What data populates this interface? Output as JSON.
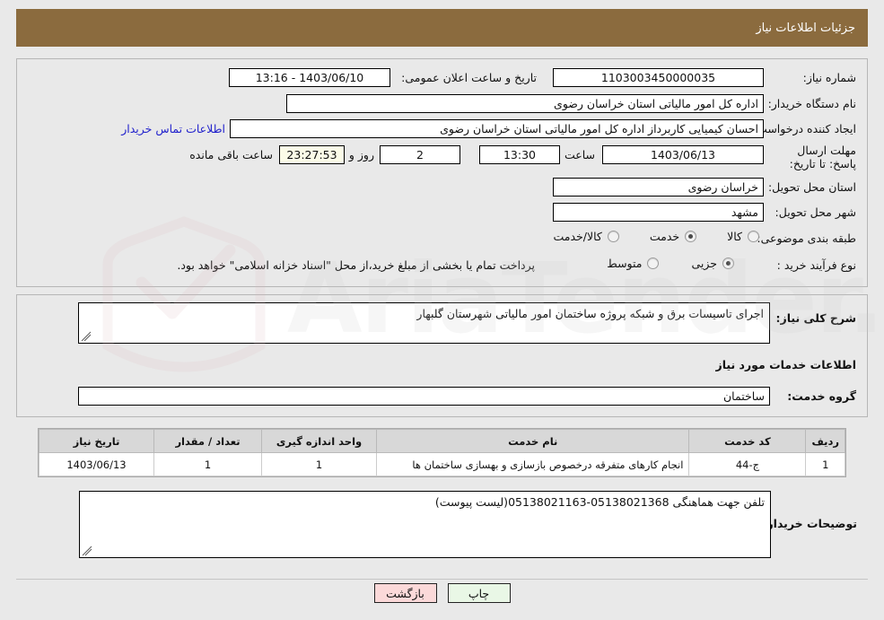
{
  "header": {
    "title": "جزئیات اطلاعات نیاز"
  },
  "fields": {
    "need_number_label": "شماره نیاز:",
    "need_number_value": "1103003450000035",
    "announce_label": "تاریخ و ساعت اعلان عمومی:",
    "announce_value": "1403/06/10 - 13:16",
    "buyer_org_label": "نام دستگاه خریدار:",
    "buyer_org_value": "اداره کل امور مالیاتی استان خراسان رضوی",
    "creator_label": "ایجاد کننده درخواست:",
    "creator_value": "احسان کیمیایی کاربرداز اداره کل امور مالیاتی استان خراسان رضوی",
    "contact_link": "اطلاعات تماس خریدار",
    "deadline_label": "مهلت ارسال پاسخ: تا تاریخ:",
    "deadline_date": "1403/06/13",
    "hour_label": "ساعت",
    "hour_value": "13:30",
    "days_value": "2",
    "days_label": "روز و",
    "timer_value": "23:27:53",
    "timer_label": "ساعت باقی مانده",
    "province_label": "استان محل تحویل:",
    "province_value": "خراسان رضوی",
    "city_label": "شهر محل تحویل:",
    "city_value": "مشهد",
    "category_label": "طبقه بندی موضوعی:",
    "process_label": "نوع فرآیند خرید :",
    "payment_note": "پرداخت تمام یا بخشی از مبلغ خرید،از محل \"اسناد خزانه اسلامی\" خواهد بود."
  },
  "category_options": [
    {
      "label": "کالا",
      "selected": false
    },
    {
      "label": "خدمت",
      "selected": true
    },
    {
      "label": "کالا/خدمت",
      "selected": false
    }
  ],
  "process_options": [
    {
      "label": "جزیی",
      "selected": true
    },
    {
      "label": "متوسط",
      "selected": false
    }
  ],
  "description": {
    "label": "شرح کلی نیاز:",
    "value": "اجرای تاسیسات برق و شبکه پروژه ساختمان امور مالیاتی شهرستان گلبهار",
    "services_head": "اطلاعات خدمات مورد نیاز",
    "group_label": "گروه خدمت:",
    "group_value": "ساختمان"
  },
  "table": {
    "columns": [
      "ردیف",
      "کد خدمت",
      "نام خدمت",
      "واحد اندازه گیری",
      "تعداد / مقدار",
      "تاریخ نیاز"
    ],
    "rows": [
      {
        "row": "1",
        "code": "ج-44",
        "name": "انجام کارهای متفرقه درخصوص بازسازی و بهسازی ساختمان ها",
        "unit": "1",
        "qty": "1",
        "date": "1403/06/13"
      }
    ]
  },
  "notes": {
    "label": "توضیحات خریدار:",
    "value": "تلفن جهت هماهنگی 05138021368-05138021163(لیست پیوست)"
  },
  "buttons": {
    "back": "بازگشت",
    "print": "چاپ"
  },
  "watermark": {
    "text": "AriaTender.net"
  },
  "colors": {
    "titlebar": "#8b6b3e",
    "link": "#2222cc",
    "back_btn": "#fbd9d9",
    "print_btn": "#e9f7e6",
    "timer_bg": "#fbfbe8"
  }
}
